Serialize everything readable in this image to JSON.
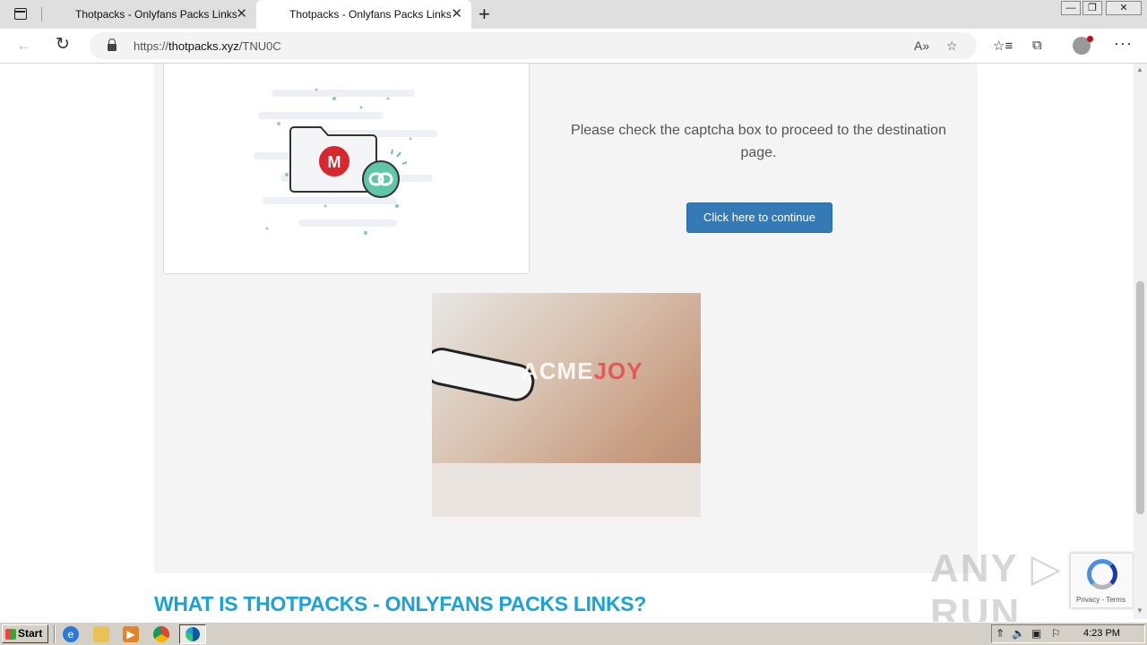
{
  "browser": {
    "tabs": [
      {
        "title": "Thotpacks - Onlyfans Packs Links",
        "close": "✕"
      },
      {
        "title": "Thotpacks - Onlyfans Packs Links",
        "close": "✕"
      }
    ],
    "new_tab": "+",
    "url_prefix": "https://",
    "url_domain": "thotpacks.xyz",
    "url_path": "/TNU0C",
    "window_controls": {
      "minimize": "—",
      "maximize": "❐",
      "close": "✕"
    }
  },
  "page": {
    "message": "Please check the captcha box to proceed to the destination page.",
    "continue_button": "Click here to continue",
    "ad_brand_main": "ACME",
    "ad_brand_accent": "JOY",
    "heading": "WHAT IS THOTPACKS - ONLYFANS PACKS LINKS?",
    "illustration_letter": "M"
  },
  "overlay": {
    "watermark": "ANY ▷ RUN",
    "recaptcha_terms": "Privacy - Terms"
  },
  "taskbar": {
    "start_label": "Start",
    "clock": "4:23 PM"
  },
  "colors": {
    "accent_heading": "#1ba3d7",
    "button_blue": "#337ab7",
    "mega_red": "#d9272e",
    "link_teal": "#5fc6a8"
  }
}
